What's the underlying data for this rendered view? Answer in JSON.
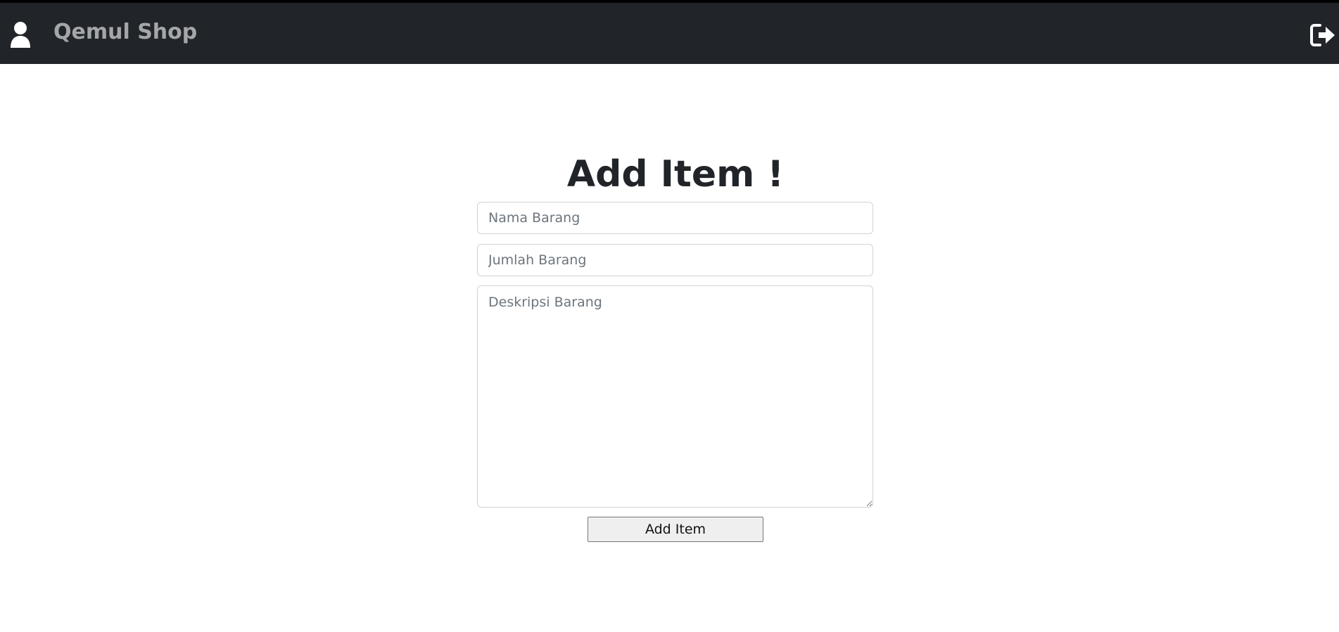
{
  "navbar": {
    "brand": "Qemul Shop",
    "user_icon": "user-icon",
    "logout_icon": "logout-icon",
    "background": "#212529"
  },
  "form": {
    "title": "Add Item !",
    "nama_placeholder": "Nama Barang",
    "jumlah_placeholder": "Jumlah Barang",
    "deskripsi_placeholder": "Deskripsi Barang",
    "submit_label": "Add Item"
  }
}
